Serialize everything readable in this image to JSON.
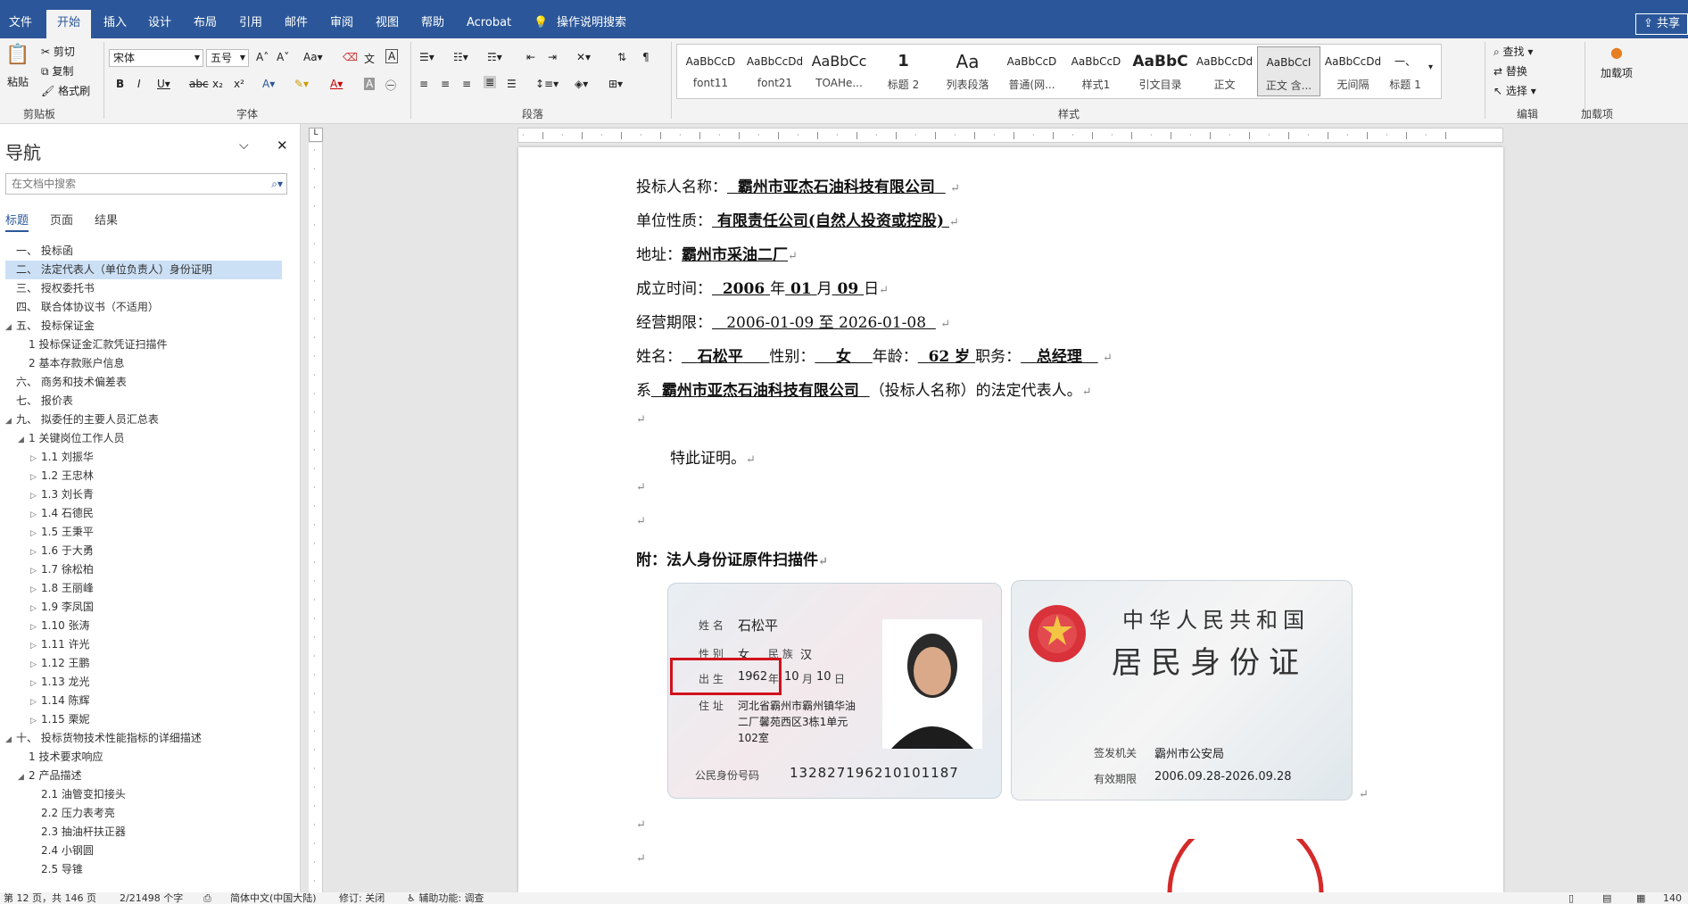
{
  "tabs": [
    "文件",
    "开始",
    "插入",
    "设计",
    "布局",
    "引用",
    "邮件",
    "审阅",
    "视图",
    "帮助",
    "Acrobat",
    "操作说明搜索"
  ],
  "share": "共享",
  "clipboard": {
    "paste": "粘贴",
    "cut": "剪切",
    "copy": "复制",
    "format_painter": "格式刷",
    "label": "剪贴板"
  },
  "font": {
    "name": "宋体",
    "size": "五号",
    "label": "字体"
  },
  "paragraph": {
    "label": "段落"
  },
  "styles": {
    "label": "样式",
    "items": [
      {
        "preview": "AaBbCcD",
        "name": "font11"
      },
      {
        "preview": "AaBbCcDd",
        "name": "font21"
      },
      {
        "preview": "AaBbCc",
        "name": "TOAHe..."
      },
      {
        "preview": "1",
        "name": "标题 2"
      },
      {
        "preview": "Aa",
        "name": "列表段落"
      },
      {
        "preview": "AaBbCcD",
        "name": "普通(网..."
      },
      {
        "preview": "AaBbCcD",
        "name": "样式1"
      },
      {
        "preview": "AaBbC",
        "name": "引文目录"
      },
      {
        "preview": "AaBbCcDd",
        "name": "正文"
      },
      {
        "preview": "AaBbCcI",
        "name": "正文 含..."
      },
      {
        "preview": "AaBbCcDd",
        "name": "无间隔"
      },
      {
        "preview": "一、",
        "name": "标题 1"
      }
    ]
  },
  "editing": {
    "find": "查找",
    "replace": "替换",
    "select": "选择",
    "label": "编辑"
  },
  "addins": {
    "load": "加载项",
    "label": "加载项"
  },
  "nav": {
    "title": "导航",
    "search_placeholder": "在文档中搜索",
    "tabs": [
      "标题",
      "页面",
      "结果"
    ],
    "items": [
      {
        "text": "一、 投标函",
        "level": 0,
        "tri": ""
      },
      {
        "text": "二、 法定代表人（单位负责人）身份证明",
        "level": 0,
        "tri": "",
        "selected": true
      },
      {
        "text": "三、 授权委托书",
        "level": 0,
        "tri": ""
      },
      {
        "text": "四、 联合体协议书（不适用）",
        "level": 0,
        "tri": ""
      },
      {
        "text": "五、 投标保证金",
        "level": 0,
        "tri": "◢"
      },
      {
        "text": "1 投标保证金汇款凭证扫描件",
        "level": 1,
        "tri": ""
      },
      {
        "text": "2 基本存款账户信息",
        "level": 1,
        "tri": ""
      },
      {
        "text": "六、 商务和技术偏差表",
        "level": 0,
        "tri": ""
      },
      {
        "text": "七、 报价表",
        "level": 0,
        "tri": ""
      },
      {
        "text": "九、 拟委任的主要人员汇总表",
        "level": 0,
        "tri": "◢"
      },
      {
        "text": "1 关键岗位工作人员",
        "level": 1,
        "tri": "◢"
      },
      {
        "text": "1.1 刘振华",
        "level": 2,
        "tri": "▷"
      },
      {
        "text": "1.2 王忠林",
        "level": 2,
        "tri": "▷"
      },
      {
        "text": "1.3 刘长青",
        "level": 2,
        "tri": "▷"
      },
      {
        "text": "1.4 石德民",
        "level": 2,
        "tri": "▷"
      },
      {
        "text": "1.5 王秉平",
        "level": 2,
        "tri": "▷"
      },
      {
        "text": "1.6 于大勇",
        "level": 2,
        "tri": "▷"
      },
      {
        "text": "1.7 徐松柏",
        "level": 2,
        "tri": "▷"
      },
      {
        "text": "1.8 王丽峰",
        "level": 2,
        "tri": "▷"
      },
      {
        "text": "1.9 李凤国",
        "level": 2,
        "tri": "▷"
      },
      {
        "text": "1.10 张涛",
        "level": 2,
        "tri": "▷"
      },
      {
        "text": "1.11 许光",
        "level": 2,
        "tri": "▷"
      },
      {
        "text": "1.12 王鹏",
        "level": 2,
        "tri": "▷"
      },
      {
        "text": "1.13 龙光",
        "level": 2,
        "tri": "▷"
      },
      {
        "text": "1.14 陈辉",
        "level": 2,
        "tri": "▷"
      },
      {
        "text": "1.15 栗妮",
        "level": 2,
        "tri": "▷"
      },
      {
        "text": "十、 投标货物技术性能指标的详细描述",
        "level": 0,
        "tri": "◢"
      },
      {
        "text": "1 技术要求响应",
        "level": 1,
        "tri": ""
      },
      {
        "text": "2 产品描述",
        "level": 1,
        "tri": "◢"
      },
      {
        "text": "2.1 油管变扣接头",
        "level": 2,
        "tri": ""
      },
      {
        "text": "2.2 压力表考亮",
        "level": 2,
        "tri": ""
      },
      {
        "text": "2.3 抽油杆扶正器",
        "level": 2,
        "tri": ""
      },
      {
        "text": "2.4 小钢圆",
        "level": 2,
        "tri": ""
      },
      {
        "text": "2.5 导锥",
        "level": 2,
        "tri": ""
      }
    ]
  },
  "doc": {
    "bidder_label": "投标人名称：",
    "bidder": "霸州市亚杰石油科技有限公司",
    "nature_label": "单位性质：",
    "nature": "有限责任公司(自然人投资或控股)",
    "address_label": "地址：",
    "address": "霸州市采油二厂",
    "founded_label": "成立时间：",
    "year": "2006",
    "year_u": "年",
    "month": "01",
    "month_u": "月",
    "day": "09",
    "day_u": "日",
    "term_label": "经营期限：",
    "term": "2006-01-09  至  2026-01-08",
    "name_label": "姓名：",
    "name": "石松平",
    "gender_label": "性别：",
    "gender": "女",
    "age_label": "年龄：",
    "age": "62 岁",
    "title_label": "职务：",
    "title": "总经理",
    "rep_prefix": "系",
    "rep_company": "霸州市亚杰石油科技有限公司",
    "rep_suffix": "（投标人名称）的法定代表人。",
    "certify": "特此证明。",
    "attach": "附：法人身份证原件扫描件"
  },
  "idcard": {
    "name_label": "姓 名",
    "name": "石松平",
    "gender_label": "性 别",
    "gender": "女",
    "ethnic_label": "民 族",
    "ethnic": "汉",
    "birth_label": "出 生",
    "birth_year": "1962",
    "birth_year_u": "年",
    "birth_month": "10",
    "birth_month_u": "月",
    "birth_day": "10",
    "birth_day_u": "日",
    "addr_label": "住 址",
    "addr1": "河北省霸州市霸州镇华油",
    "addr2": "二厂馨苑西区3栋1单元",
    "addr3": "102室",
    "id_label": "公民身份号码",
    "id": "132827196210101187",
    "back_title1": "中华人民共和国",
    "back_title2": "居民身份证",
    "authority_label": "签发机关",
    "authority": "霸州市公安局",
    "valid_label": "有效期限",
    "valid": "2006.09.28-2026.09.28"
  },
  "status": {
    "page": "第 12 页，共 146 页",
    "words": "2/21498 个字",
    "lang": "简体中文(中国大陆)",
    "track": "修订: 关闭",
    "access": "辅助功能: 调查",
    "zoom": "140"
  }
}
